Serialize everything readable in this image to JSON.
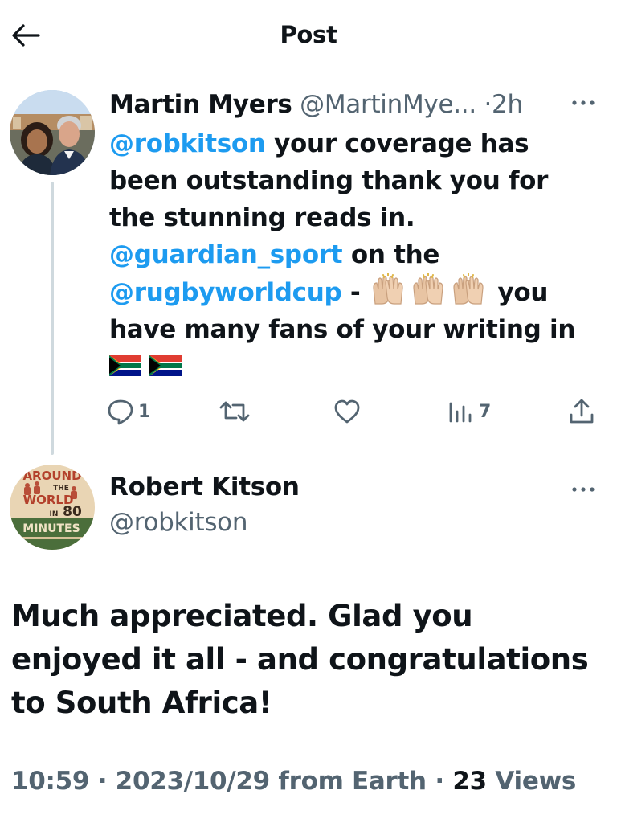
{
  "header": {
    "title": "Post"
  },
  "reply": {
    "author_name": "Martin Myers",
    "author_handle": "@MartinMye...",
    "separator": "·",
    "time": "2h",
    "text_parts": {
      "mention1": "@robkitson",
      "t1": " your coverage has been outstanding thank you for the stunning reads  in. ",
      "mention2": "@guardian_sport",
      "t2": " on the ",
      "mention3": "@rugbyworldcup",
      "t3": " - ",
      "t4": " you have many fans of your writing in"
    },
    "clap_emoji_count": 3,
    "flag_emoji_count": 2,
    "actions": {
      "replies": "1",
      "retweets": "",
      "likes": "",
      "views": "7"
    }
  },
  "main_post": {
    "author_name": "Robert Kitson",
    "author_handle": "@robkitson",
    "avatar_text": {
      "l1": "AROUND",
      "l2": "THE",
      "l3": "WORLD",
      "l4": "IN",
      "l5": "80",
      "l6": "MINUTES"
    },
    "text": "Much appreciated. Glad you enjoyed it all - and congratulations to South Africa!",
    "time": "10:59",
    "date": "2023/10/29",
    "source": "from Earth",
    "views_count": "23",
    "views_label": "Views",
    "separator": "·"
  },
  "icons": [
    "back-arrow-icon",
    "more-icon",
    "reply-icon",
    "retweet-icon",
    "like-icon",
    "views-icon",
    "share-icon",
    "clapping-hands-icon",
    "south-africa-flag-icon"
  ],
  "colors": {
    "accent": "#1d9bf0",
    "muted": "#536471",
    "text": "#0f1419",
    "thread_line": "#cfd9de"
  }
}
